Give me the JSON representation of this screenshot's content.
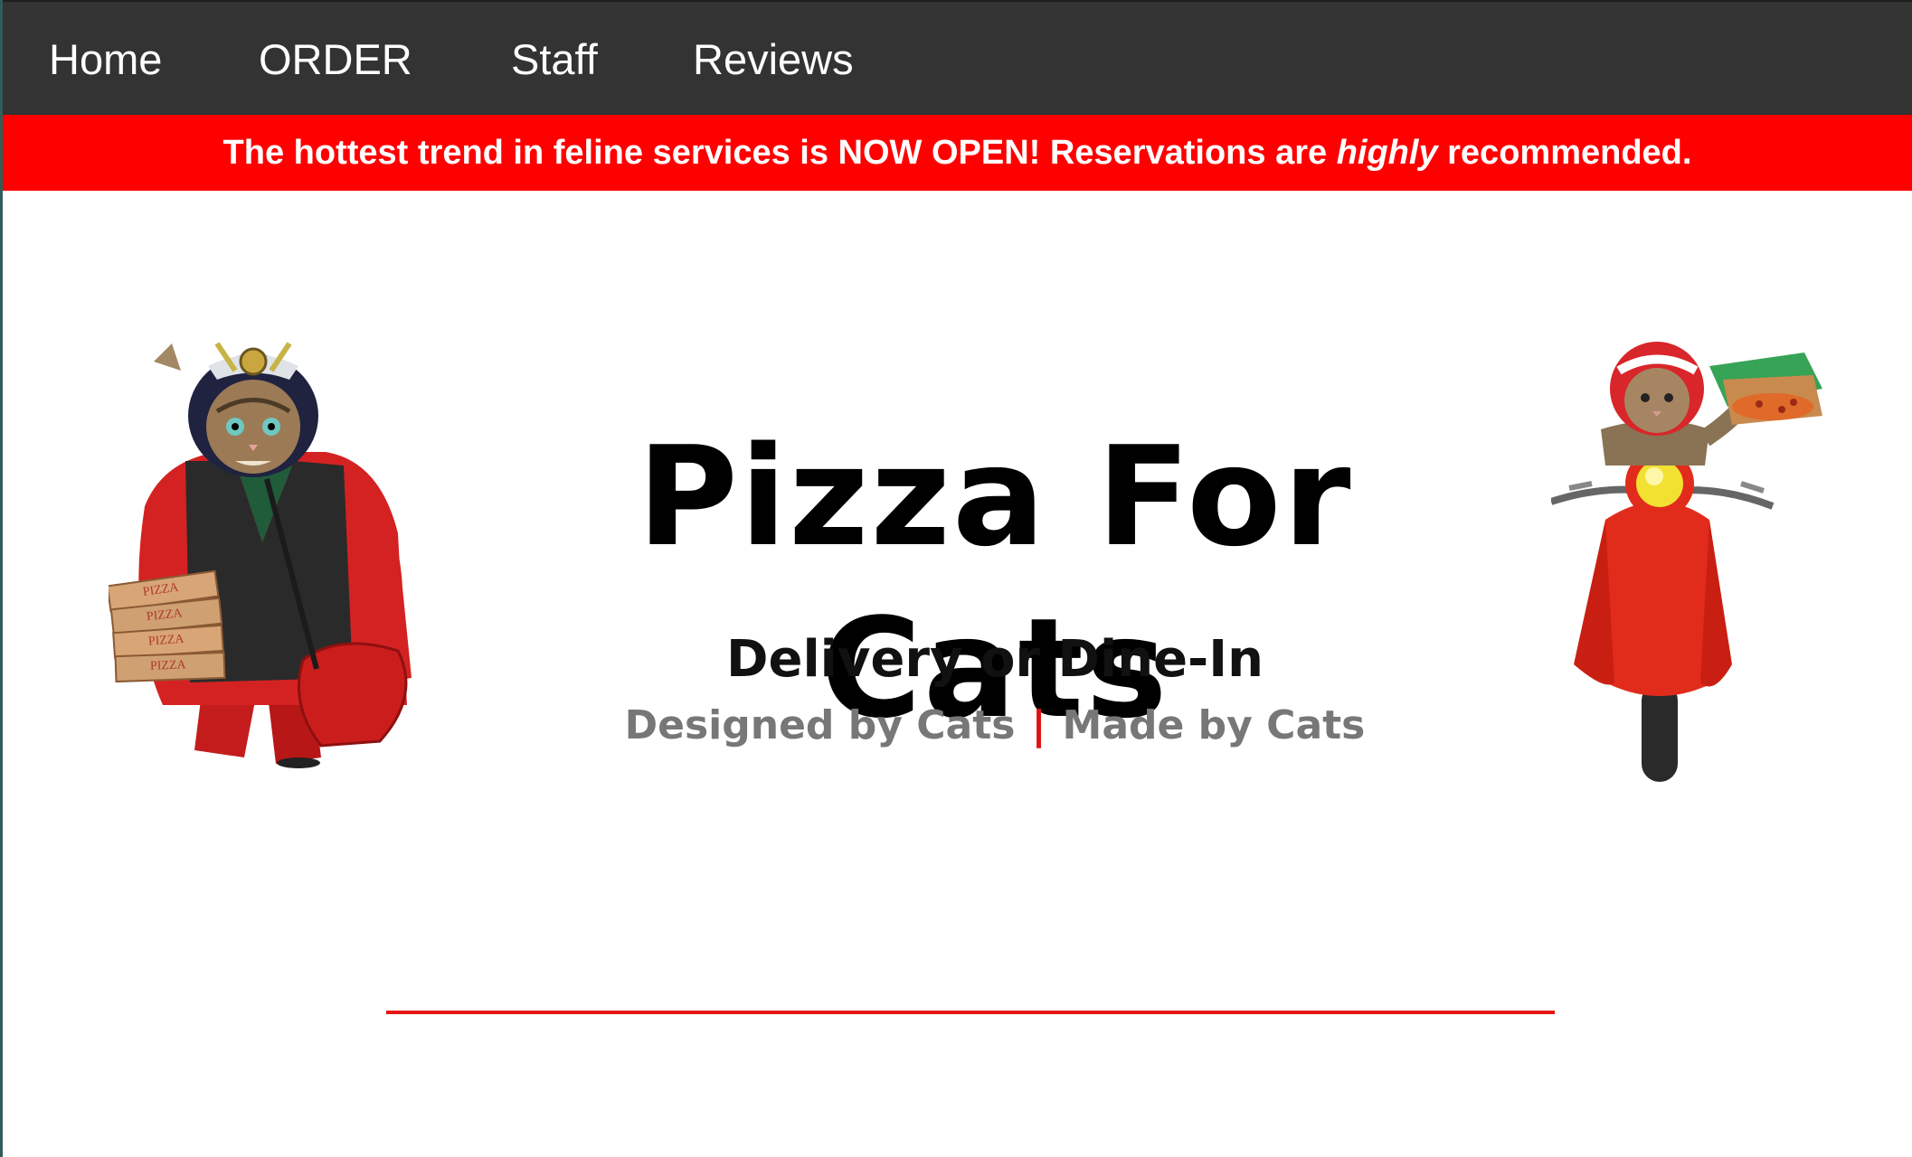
{
  "nav": {
    "items": [
      {
        "label": "Home"
      },
      {
        "label": "ORDER"
      },
      {
        "label": "Staff"
      },
      {
        "label": "Reviews"
      }
    ]
  },
  "banner": {
    "text_before": "The hottest trend in feline services is NOW OPEN! Reservations are ",
    "emphasis": "highly",
    "text_after": " recommended."
  },
  "hero": {
    "title": "Pizza For Cats",
    "subtitle": "Delivery or Dine-In",
    "tagline_left": "Designed by Cats",
    "tagline_divider": "|",
    "tagline_right": "Made by Cats"
  },
  "images": {
    "left": {
      "box_labels": [
        "PIZZA",
        "PIZZA",
        "PIZZA",
        "PIZZA"
      ]
    }
  },
  "colors": {
    "nav_bg": "#333333",
    "banner_bg": "#ff0000",
    "accent": "#e51818"
  }
}
